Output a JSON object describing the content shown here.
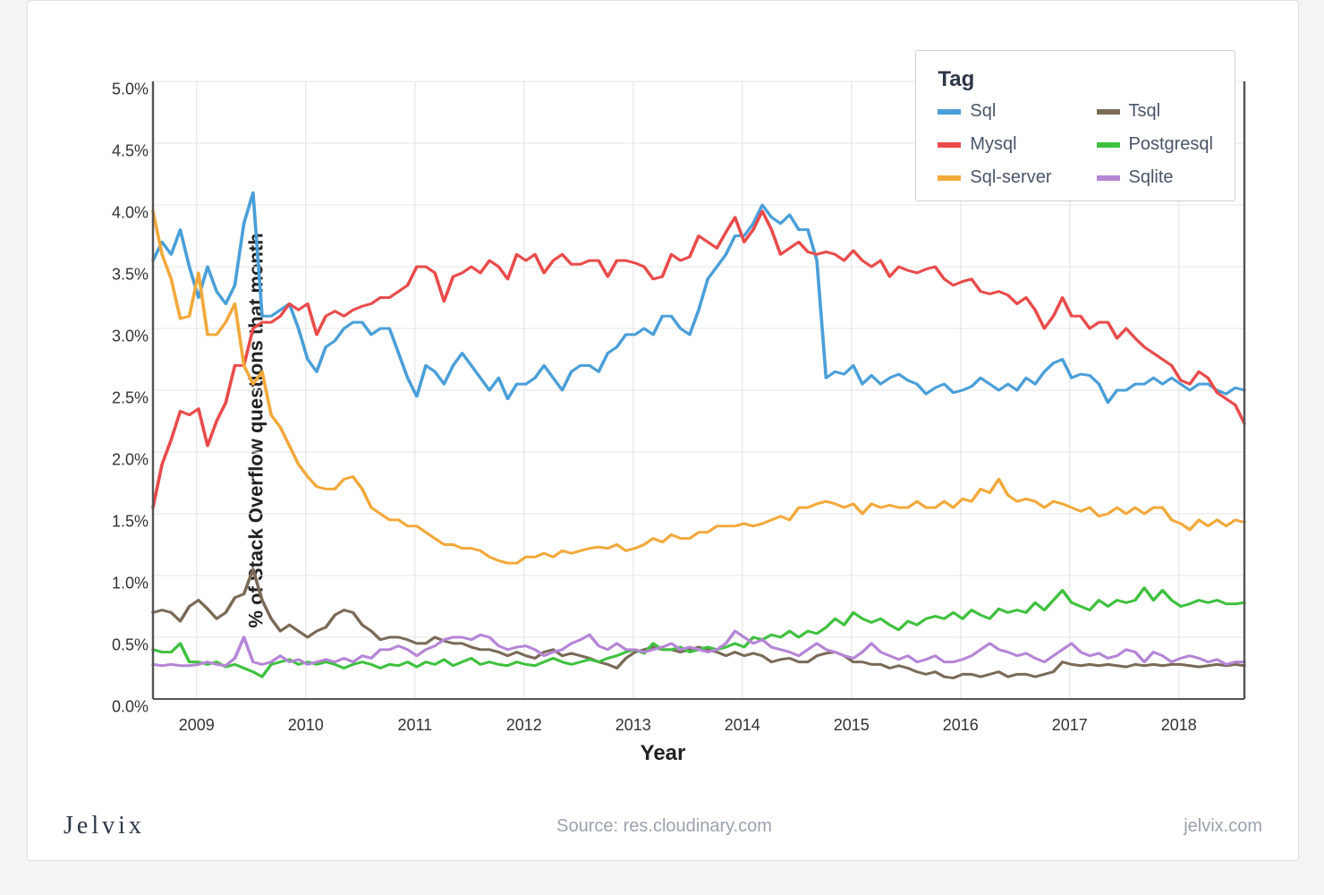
{
  "chart_data": {
    "type": "line",
    "title": "",
    "xlabel": "Year",
    "ylabel": "% of Stack Overflow questions that month",
    "x_start": 2008.6,
    "x_end": 2018.6,
    "x_step_months": 1,
    "xlim": [
      2008.6,
      2018.6
    ],
    "ylim": [
      0.0,
      5.0
    ],
    "yticks": [
      0.0,
      0.5,
      1.0,
      1.5,
      2.0,
      2.5,
      3.0,
      3.5,
      4.0,
      4.5,
      5.0
    ],
    "ytick_labels": [
      "0.0%",
      "0.5%",
      "1.0%",
      "1.5%",
      "2.0%",
      "2.5%",
      "3.0%",
      "3.5%",
      "4.0%",
      "4.5%",
      "5.0%"
    ],
    "xticks": [
      2009,
      2010,
      2011,
      2012,
      2013,
      2014,
      2015,
      2016,
      2017,
      2018
    ],
    "legend_title": "Tag",
    "series": [
      {
        "name": "Sql",
        "color": "#4a9fd8",
        "values": [
          3.55,
          3.7,
          3.6,
          3.8,
          3.5,
          3.25,
          3.5,
          3.3,
          3.2,
          3.35,
          3.85,
          4.1,
          3.1,
          3.1,
          3.15,
          3.2,
          3.0,
          2.75,
          2.65,
          2.85,
          2.9,
          3.0,
          3.05,
          3.05,
          2.95,
          3.0,
          3.0,
          2.8,
          2.6,
          2.45,
          2.7,
          2.65,
          2.55,
          2.7,
          2.8,
          2.7,
          2.6,
          2.5,
          2.6,
          2.43,
          2.55,
          2.55,
          2.6,
          2.7,
          2.6,
          2.5,
          2.65,
          2.7,
          2.7,
          2.65,
          2.8,
          2.85,
          2.95,
          2.95,
          3.0,
          2.95,
          3.1,
          3.1,
          3.0,
          2.95,
          3.15,
          3.4,
          3.5,
          3.6,
          3.75,
          3.75,
          3.85,
          4.0,
          3.9,
          3.85,
          3.92,
          3.8,
          3.8,
          3.55,
          2.6,
          2.65,
          2.63,
          2.7,
          2.55,
          2.62,
          2.55,
          2.6,
          2.63,
          2.58,
          2.55,
          2.47,
          2.52,
          2.55,
          2.48,
          2.5,
          2.53,
          2.6,
          2.55,
          2.5,
          2.55,
          2.5,
          2.6,
          2.55,
          2.65,
          2.72,
          2.75,
          2.6,
          2.63,
          2.62,
          2.55,
          2.4,
          2.5,
          2.5,
          2.55,
          2.55,
          2.6,
          2.55,
          2.6,
          2.55,
          2.5,
          2.55,
          2.55,
          2.5,
          2.47,
          2.52,
          2.5
        ]
      },
      {
        "name": "Mysql",
        "color": "#e94b4b",
        "values": [
          1.55,
          1.9,
          2.1,
          2.33,
          2.3,
          2.35,
          2.05,
          2.25,
          2.4,
          2.7,
          2.7,
          3.0,
          3.05,
          3.05,
          3.1,
          3.2,
          3.15,
          3.2,
          2.95,
          3.1,
          3.14,
          3.1,
          3.15,
          3.18,
          3.2,
          3.25,
          3.25,
          3.3,
          3.35,
          3.5,
          3.5,
          3.45,
          3.22,
          3.42,
          3.45,
          3.5,
          3.45,
          3.55,
          3.5,
          3.4,
          3.6,
          3.55,
          3.6,
          3.45,
          3.55,
          3.6,
          3.52,
          3.52,
          3.55,
          3.55,
          3.42,
          3.55,
          3.55,
          3.53,
          3.5,
          3.4,
          3.42,
          3.6,
          3.55,
          3.58,
          3.75,
          3.7,
          3.65,
          3.78,
          3.9,
          3.7,
          3.8,
          3.95,
          3.8,
          3.6,
          3.65,
          3.7,
          3.62,
          3.6,
          3.62,
          3.6,
          3.55,
          3.63,
          3.55,
          3.5,
          3.55,
          3.42,
          3.5,
          3.47,
          3.45,
          3.48,
          3.5,
          3.4,
          3.35,
          3.38,
          3.4,
          3.3,
          3.28,
          3.3,
          3.27,
          3.2,
          3.25,
          3.15,
          3.0,
          3.1,
          3.25,
          3.1,
          3.1,
          3.0,
          3.05,
          3.05,
          2.92,
          3.0,
          2.92,
          2.85,
          2.8,
          2.75,
          2.7,
          2.58,
          2.55,
          2.65,
          2.6,
          2.48,
          2.43,
          2.38,
          2.23
        ]
      },
      {
        "name": "Sql-server",
        "color": "#f2a93b",
        "values": [
          3.95,
          3.6,
          3.4,
          3.08,
          3.1,
          3.45,
          2.95,
          2.95,
          3.05,
          3.2,
          2.7,
          2.55,
          2.65,
          2.3,
          2.2,
          2.05,
          1.9,
          1.8,
          1.72,
          1.7,
          1.7,
          1.78,
          1.8,
          1.7,
          1.55,
          1.5,
          1.45,
          1.45,
          1.4,
          1.4,
          1.35,
          1.3,
          1.25,
          1.25,
          1.22,
          1.22,
          1.2,
          1.15,
          1.12,
          1.1,
          1.1,
          1.15,
          1.15,
          1.18,
          1.15,
          1.2,
          1.18,
          1.2,
          1.22,
          1.23,
          1.22,
          1.25,
          1.2,
          1.22,
          1.25,
          1.3,
          1.27,
          1.33,
          1.3,
          1.3,
          1.35,
          1.35,
          1.4,
          1.4,
          1.4,
          1.42,
          1.4,
          1.42,
          1.45,
          1.48,
          1.45,
          1.55,
          1.55,
          1.58,
          1.6,
          1.58,
          1.55,
          1.58,
          1.5,
          1.58,
          1.55,
          1.57,
          1.55,
          1.55,
          1.6,
          1.55,
          1.55,
          1.6,
          1.55,
          1.62,
          1.6,
          1.7,
          1.67,
          1.78,
          1.65,
          1.6,
          1.62,
          1.6,
          1.55,
          1.6,
          1.58,
          1.55,
          1.52,
          1.55,
          1.48,
          1.5,
          1.55,
          1.5,
          1.55,
          1.5,
          1.55,
          1.55,
          1.45,
          1.42,
          1.37,
          1.45,
          1.4,
          1.45,
          1.4,
          1.45,
          1.43
        ]
      },
      {
        "name": "Tsql",
        "color": "#7a6a58",
        "values": [
          0.7,
          0.72,
          0.7,
          0.63,
          0.75,
          0.8,
          0.73,
          0.65,
          0.7,
          0.82,
          0.85,
          1.05,
          0.8,
          0.65,
          0.55,
          0.6,
          0.55,
          0.5,
          0.55,
          0.58,
          0.68,
          0.72,
          0.7,
          0.6,
          0.55,
          0.48,
          0.5,
          0.5,
          0.48,
          0.45,
          0.45,
          0.5,
          0.47,
          0.45,
          0.45,
          0.42,
          0.4,
          0.4,
          0.38,
          0.35,
          0.38,
          0.35,
          0.33,
          0.38,
          0.4,
          0.35,
          0.37,
          0.35,
          0.33,
          0.3,
          0.28,
          0.25,
          0.33,
          0.38,
          0.4,
          0.42,
          0.4,
          0.4,
          0.38,
          0.4,
          0.42,
          0.4,
          0.38,
          0.35,
          0.38,
          0.35,
          0.37,
          0.35,
          0.3,
          0.32,
          0.33,
          0.3,
          0.3,
          0.35,
          0.37,
          0.38,
          0.35,
          0.3,
          0.3,
          0.28,
          0.28,
          0.25,
          0.27,
          0.25,
          0.22,
          0.2,
          0.22,
          0.18,
          0.17,
          0.2,
          0.2,
          0.18,
          0.2,
          0.22,
          0.18,
          0.2,
          0.2,
          0.18,
          0.2,
          0.22,
          0.3,
          0.28,
          0.27,
          0.28,
          0.27,
          0.28,
          0.27,
          0.26,
          0.28,
          0.27,
          0.28,
          0.27,
          0.28,
          0.28,
          0.27,
          0.26,
          0.27,
          0.28,
          0.27,
          0.28,
          0.27
        ]
      },
      {
        "name": "Postgresql",
        "color": "#3fc13f",
        "values": [
          0.4,
          0.38,
          0.38,
          0.45,
          0.3,
          0.3,
          0.28,
          0.3,
          0.26,
          0.28,
          0.25,
          0.22,
          0.18,
          0.28,
          0.3,
          0.32,
          0.28,
          0.3,
          0.28,
          0.3,
          0.28,
          0.25,
          0.28,
          0.3,
          0.28,
          0.25,
          0.28,
          0.27,
          0.3,
          0.26,
          0.3,
          0.28,
          0.32,
          0.27,
          0.3,
          0.33,
          0.28,
          0.3,
          0.28,
          0.27,
          0.3,
          0.28,
          0.27,
          0.3,
          0.33,
          0.3,
          0.28,
          0.3,
          0.32,
          0.3,
          0.33,
          0.35,
          0.38,
          0.4,
          0.37,
          0.45,
          0.4,
          0.4,
          0.42,
          0.38,
          0.4,
          0.42,
          0.4,
          0.42,
          0.45,
          0.42,
          0.5,
          0.48,
          0.52,
          0.5,
          0.55,
          0.5,
          0.55,
          0.53,
          0.58,
          0.65,
          0.6,
          0.7,
          0.65,
          0.62,
          0.65,
          0.6,
          0.56,
          0.63,
          0.6,
          0.65,
          0.67,
          0.65,
          0.7,
          0.65,
          0.72,
          0.68,
          0.65,
          0.73,
          0.7,
          0.72,
          0.7,
          0.78,
          0.72,
          0.8,
          0.88,
          0.78,
          0.75,
          0.72,
          0.8,
          0.75,
          0.8,
          0.78,
          0.8,
          0.9,
          0.8,
          0.88,
          0.8,
          0.75,
          0.77,
          0.8,
          0.78,
          0.8,
          0.77,
          0.77,
          0.78
        ]
      },
      {
        "name": "Sqlite",
        "color": "#b586d6",
        "values": [
          0.28,
          0.27,
          0.28,
          0.27,
          0.27,
          0.28,
          0.3,
          0.28,
          0.27,
          0.33,
          0.5,
          0.3,
          0.28,
          0.3,
          0.35,
          0.3,
          0.32,
          0.28,
          0.3,
          0.32,
          0.3,
          0.33,
          0.3,
          0.35,
          0.33,
          0.4,
          0.4,
          0.43,
          0.4,
          0.35,
          0.4,
          0.43,
          0.48,
          0.5,
          0.5,
          0.48,
          0.52,
          0.5,
          0.43,
          0.4,
          0.42,
          0.43,
          0.4,
          0.35,
          0.38,
          0.4,
          0.45,
          0.48,
          0.52,
          0.43,
          0.4,
          0.45,
          0.4,
          0.4,
          0.38,
          0.4,
          0.42,
          0.45,
          0.4,
          0.42,
          0.4,
          0.38,
          0.4,
          0.45,
          0.55,
          0.5,
          0.45,
          0.48,
          0.42,
          0.4,
          0.38,
          0.35,
          0.4,
          0.45,
          0.4,
          0.38,
          0.35,
          0.33,
          0.38,
          0.45,
          0.38,
          0.35,
          0.32,
          0.35,
          0.3,
          0.32,
          0.35,
          0.3,
          0.3,
          0.32,
          0.35,
          0.4,
          0.45,
          0.4,
          0.38,
          0.35,
          0.37,
          0.33,
          0.3,
          0.35,
          0.4,
          0.45,
          0.38,
          0.35,
          0.37,
          0.33,
          0.35,
          0.4,
          0.38,
          0.3,
          0.38,
          0.35,
          0.3,
          0.33,
          0.35,
          0.33,
          0.3,
          0.32,
          0.28,
          0.3,
          0.3
        ]
      }
    ]
  },
  "footer": {
    "brand": "Jelvix",
    "source_prefix": "Source: ",
    "source": "res.cloudinary.com",
    "site": "jelvix.com"
  }
}
